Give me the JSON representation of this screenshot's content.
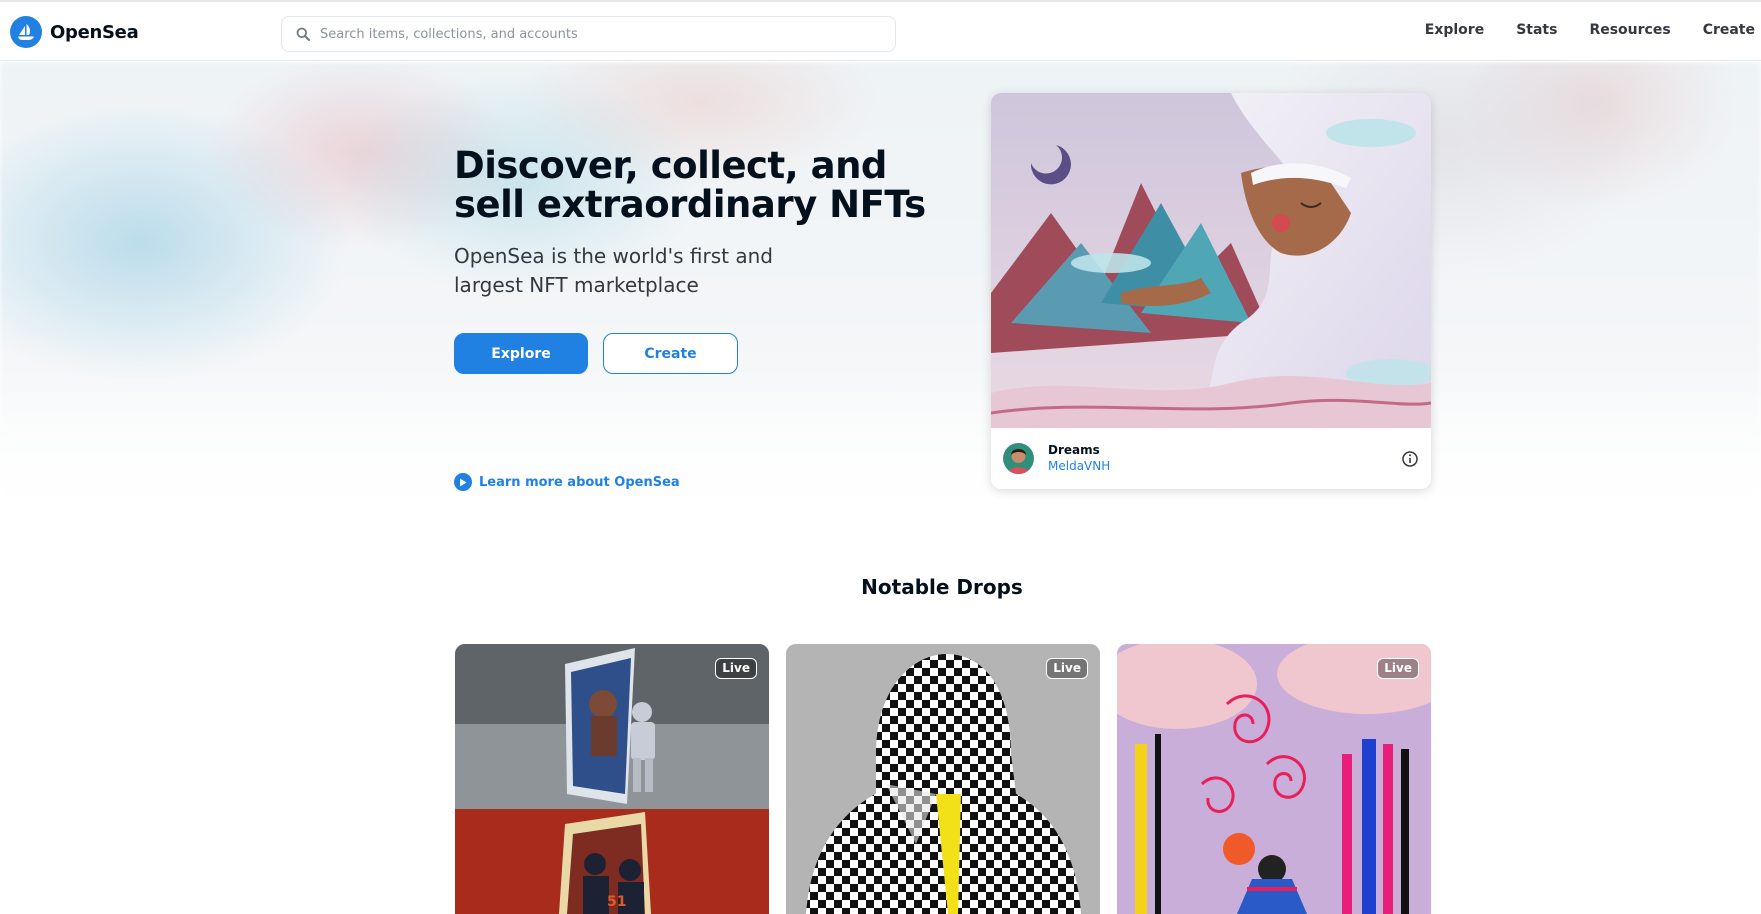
{
  "header": {
    "brand_name": "OpenSea",
    "search_placeholder": "Search items, collections, and accounts",
    "nav": [
      {
        "label": "Explore"
      },
      {
        "label": "Stats"
      },
      {
        "label": "Resources"
      },
      {
        "label": "Create"
      }
    ]
  },
  "hero": {
    "title": "Discover, collect, and sell extraordinary NFTs",
    "subtitle": "OpenSea is the world's first and largest NFT marketplace",
    "explore_button": "Explore",
    "create_button": "Create",
    "learn_more": "Learn more about OpenSea"
  },
  "featured": {
    "name": "Dreams",
    "creator": "MeldaVNH",
    "icon": "info-icon"
  },
  "notable_drops": {
    "title": "Notable Drops",
    "items": [
      {
        "badge": "Live"
      },
      {
        "badge": "Live"
      },
      {
        "badge": "Live"
      }
    ]
  },
  "colors": {
    "accent": "#2081e2",
    "text": "#04111d",
    "border": "#e5e8eb"
  }
}
